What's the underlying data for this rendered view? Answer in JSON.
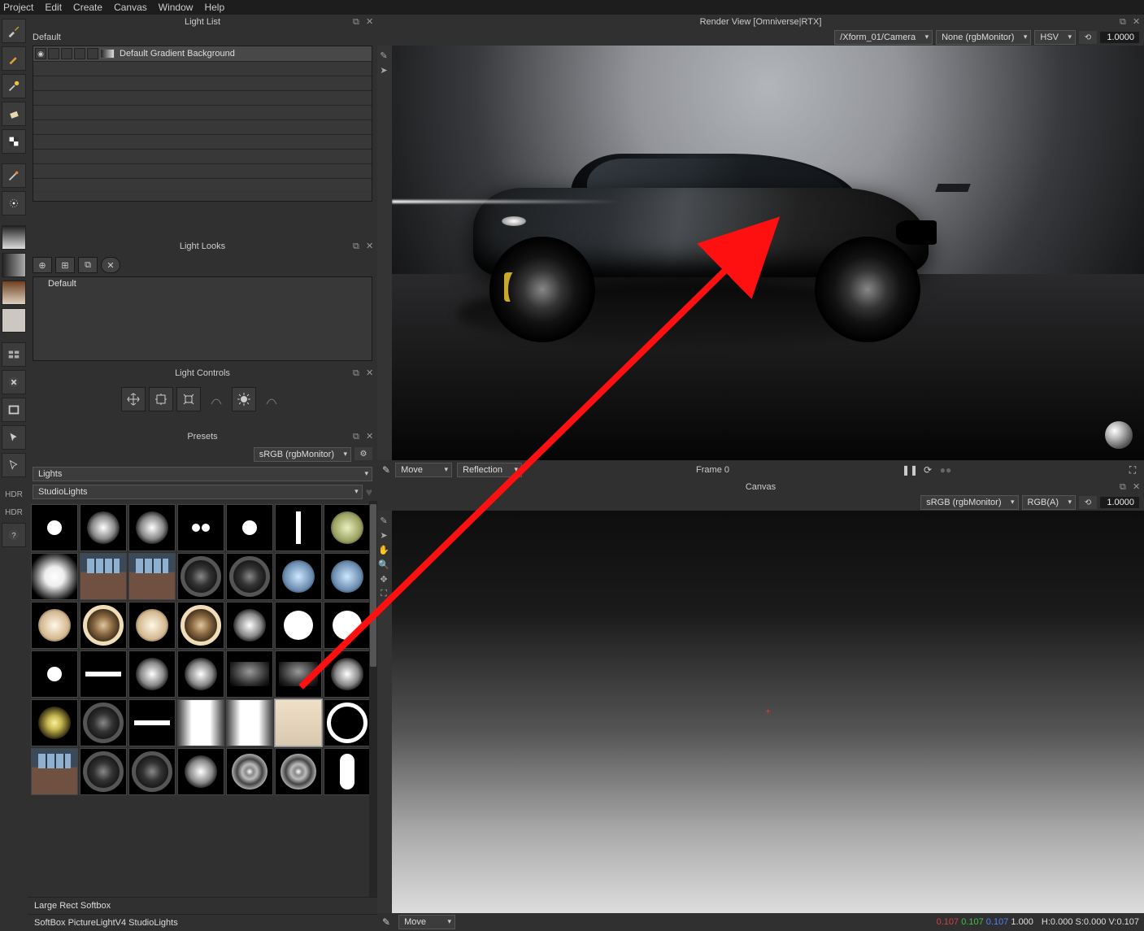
{
  "menu": [
    "Project",
    "Edit",
    "Create",
    "Canvas",
    "Window",
    "Help"
  ],
  "leftToolbar": {
    "items": [
      "brush",
      "pen",
      "spark",
      "eraser",
      "checker",
      "",
      "wand",
      "spray",
      "",
      "",
      "grad1",
      "grad2",
      "grad3",
      "grad4",
      "",
      "layout",
      "close",
      "rect",
      "arrow",
      "arrow2",
      "",
      "hdr1",
      "hdr2",
      "help"
    ]
  },
  "lightList": {
    "title": "Light List",
    "defaultLabel": "Default",
    "row": {
      "name": "Default Gradient Background"
    }
  },
  "lightLooks": {
    "title": "Light Looks",
    "item": "Default"
  },
  "lightControls": {
    "title": "Light Controls"
  },
  "presets": {
    "title": "Presets",
    "monitor": "sRGB (rgbMonitor)",
    "category": "Lights",
    "sub": "StudioLights",
    "selectedName": "Large Rect Softbox",
    "path": "SoftBox PictureLightV4 StudioLights",
    "thumbs": [
      "dot",
      "glow",
      "glow",
      "dotpair",
      "dot",
      "barv",
      "green",
      "soft",
      "room",
      "room",
      "ring-dark",
      "ring-dark",
      "blue",
      "blue-soft",
      "warm",
      "ring-warm",
      "warm",
      "ring-warm",
      "glow",
      "dot-big",
      "dot-big",
      "dot",
      "bar",
      "glow",
      "glow",
      "grad",
      "grad",
      "glow",
      "star",
      "ring-dark",
      "bar",
      "panel",
      "panel",
      "rect",
      "ring",
      "room",
      "ring-dark",
      "ring-dark",
      "glow",
      "chrome",
      "chrome",
      "pill"
    ],
    "selectedIndex": 33
  },
  "renderView": {
    "title": "Render View [Omniverse|RTX]",
    "camera": "/Xform_01/Camera",
    "monitor": "None (rgbMonitor)",
    "colorspace": "HSV",
    "exposure": "1.0000"
  },
  "transport": {
    "tool": "Move",
    "mode": "Reflection",
    "frame": "Frame 0"
  },
  "canvas": {
    "title": "Canvas",
    "monitor": "sRGB (rgbMonitor)",
    "channel": "RGB(A)",
    "exposure": "1.0000",
    "tool": "Move"
  },
  "status": {
    "r": "0.107",
    "g": "0.107",
    "b": "0.107",
    "a": "1.000",
    "hsv": "H:0.000 S:0.000 V:0.107"
  },
  "hdrLabels": {
    "h1": "HDR",
    "h2": "HDR"
  }
}
